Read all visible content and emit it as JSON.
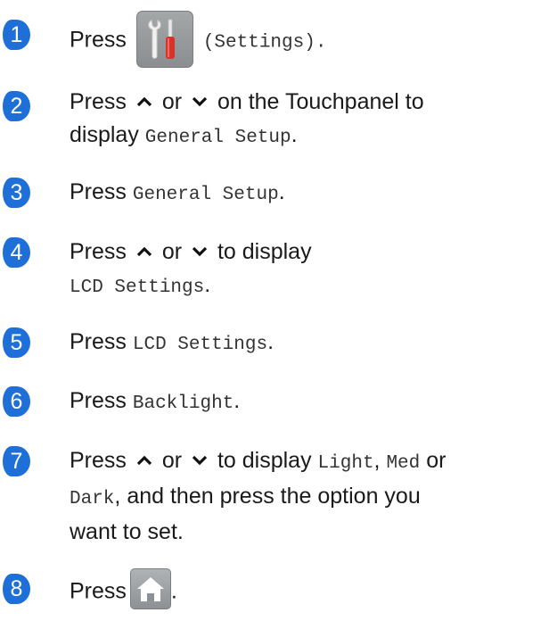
{
  "steps": [
    {
      "num": "1",
      "parts": {
        "a": "Press",
        "b": "(Settings)."
      }
    },
    {
      "num": "2",
      "parts": {
        "a": "Press",
        "b": "or",
        "c": "on the Touchpanel to",
        "d": "display",
        "e": "General Setup",
        "f": "."
      }
    },
    {
      "num": "3",
      "parts": {
        "a": "Press",
        "b": "General Setup",
        "c": "."
      }
    },
    {
      "num": "4",
      "parts": {
        "a": "Press",
        "b": "or",
        "c": "to display",
        "d": "LCD Settings",
        "e": "."
      }
    },
    {
      "num": "5",
      "parts": {
        "a": "Press",
        "b": "LCD Settings",
        "c": "."
      }
    },
    {
      "num": "6",
      "parts": {
        "a": "Press",
        "b": "Backlight",
        "c": "."
      }
    },
    {
      "num": "7",
      "parts": {
        "a": "Press",
        "b": "or",
        "c": "to display",
        "d": "Light",
        "e": ",",
        "f": "Med",
        "g": "or",
        "h": "Dark",
        "i": ", and then press the option you",
        "j": "want to set."
      }
    },
    {
      "num": "8",
      "parts": {
        "a": "Press",
        "b": "."
      }
    }
  ],
  "icons": {
    "settings": "settings-icon",
    "home": "home-icon",
    "up": "chevron-up-icon",
    "down": "chevron-down-icon"
  },
  "colors": {
    "badge": "#1f6fd8",
    "icon_bg": "#9a9d9f"
  }
}
